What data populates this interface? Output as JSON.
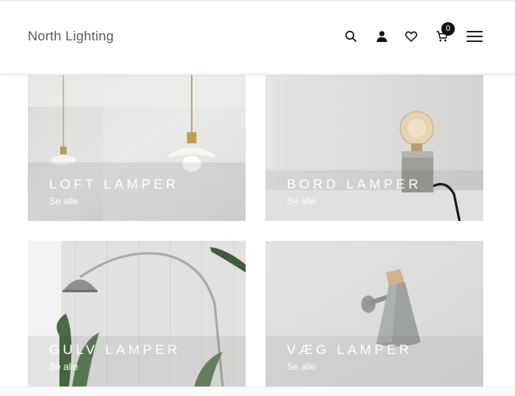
{
  "site": {
    "logo": "North Lighting"
  },
  "header": {
    "icons": [
      "search-icon",
      "user-icon",
      "heart-icon",
      "cart-icon",
      "menu-icon"
    ],
    "cart_count": "0"
  },
  "categories": [
    {
      "title": "LOFT LAMPER",
      "link": "Se alle"
    },
    {
      "title": "BORD LAMPER",
      "link": "Se alle"
    },
    {
      "title": "GULV LAMPER",
      "link": "Se alle"
    },
    {
      "title": "VÆG LAMPER",
      "link": "Se alle"
    }
  ]
}
